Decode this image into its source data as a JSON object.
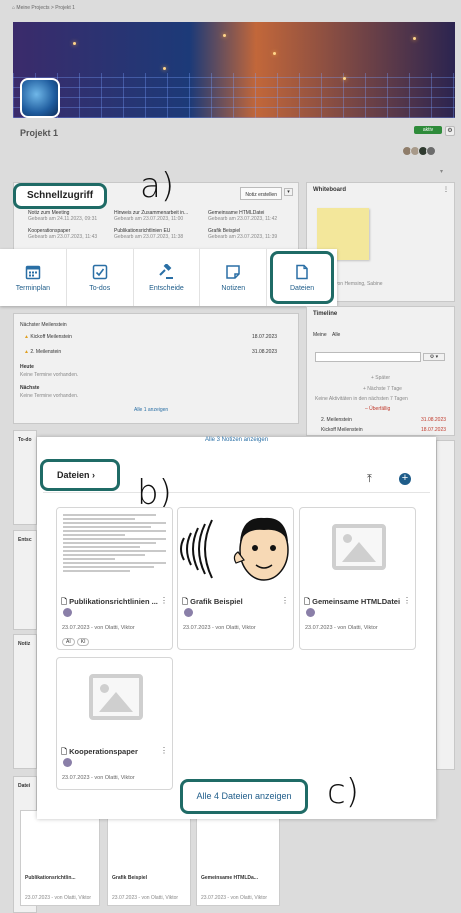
{
  "breadcrumb": {
    "root": "Meine Projects",
    "current": "Projekt 1"
  },
  "project": {
    "title": "Projekt 1",
    "status": "aktiv"
  },
  "annotations": {
    "a": "a)",
    "b": "b)",
    "c": "c)"
  },
  "quick_access": {
    "title": "Schnellzugriff",
    "new_note_button": "Notiz erstellen",
    "notes": [
      {
        "title": "Notiz zum Meeting",
        "meta": "Gebearb am 24.11.2023, 09:31"
      },
      {
        "title": "Hinweis zur Zusammenarbeit in...",
        "meta": "Gebearb am 23.07.2023, 11:00"
      },
      {
        "title": "Gemeinsame HTMLDatei",
        "meta": "Gebearb am 23.07.2023, 11:42"
      },
      {
        "title": "Kooperationspaper",
        "meta": "Gebearb am 23.07.2023, 11:43"
      },
      {
        "title": "Publikationsrichtlinien EU",
        "meta": "Gebearb am 23.07.2023, 11:38"
      },
      {
        "title": "Grafik Beispiel",
        "meta": "Gebearb am 23.07.2023, 11:39"
      }
    ],
    "tiles": [
      {
        "label": "Terminplan",
        "icon": "calendar-icon"
      },
      {
        "label": "To-dos",
        "icon": "checkbox-icon"
      },
      {
        "label": "Entscheide",
        "icon": "gavel-icon"
      },
      {
        "label": "Notizen",
        "icon": "note-icon"
      },
      {
        "label": "Dateien",
        "icon": "file-icon"
      }
    ]
  },
  "schedule": {
    "next_milestone_label": "Nächster Meilenstein",
    "milestones": [
      {
        "name": "Kickoff Meilenstein",
        "date": "18.07.2023"
      },
      {
        "name": "2. Meilenstein",
        "date": "31.08.2023"
      }
    ],
    "today_label": "Heute",
    "today_empty": "Keine Termine vorhanden.",
    "next_label": "Nächste",
    "next_empty": "Keine Termine vorhanden.",
    "show_all": "Alle 1 anzeigen"
  },
  "side_labels": {
    "todos": "To-do",
    "decisions": "Entsc",
    "notes": "Notiz",
    "files": "Datei"
  },
  "whiteboard": {
    "title": "Whiteboard",
    "caption": "von Hemsing, Sabine"
  },
  "timeline": {
    "title": "Timeline",
    "tabs": [
      "Meine",
      "Alle"
    ],
    "earlier": "+ Später",
    "next_days": "+ Nächste 7 Tage",
    "none_text": "Keine Aktivitäten in den nächsten 7 Tagen",
    "overdue": "– Überfällig",
    "rows": [
      {
        "name": "2. Meilenstein",
        "date": "31.08.2023"
      },
      {
        "name": "Kickoff Meilenstein",
        "date": "18.07.2023"
      }
    ]
  },
  "notes_link": "Alle 3 Notizen anzeigen",
  "files": {
    "header": "Dateien",
    "show_all": "Alle 4 Dateien anzeigen",
    "items": [
      {
        "name": "Publikationsrichtlinien ...",
        "meta": "23.07.2023 - von Olatti, Viktor",
        "tags": [
          "AI",
          "KI"
        ]
      },
      {
        "name": "Grafik Beispiel",
        "meta": "23.07.2023 - von Olatti, Viktor",
        "tags": []
      },
      {
        "name": "Gemeinsame HTMLDatei",
        "meta": "23.07.2023 - von Olatti, Viktor",
        "tags": []
      },
      {
        "name": "Kooperationspaper",
        "meta": "23.07.2023 - von Olatti, Viktor",
        "tags": []
      }
    ]
  },
  "bg_files": [
    {
      "name": "Publikationsrichtlin...",
      "meta": "23.07.2023 - von Olatti, Viktor"
    },
    {
      "name": "Grafik Beispiel",
      "meta": "23.07.2023 - von Olatti, Viktor"
    },
    {
      "name": "Gemeinsame HTMLDa...",
      "meta": "23.07.2023 - von Olatti, Viktor"
    }
  ]
}
